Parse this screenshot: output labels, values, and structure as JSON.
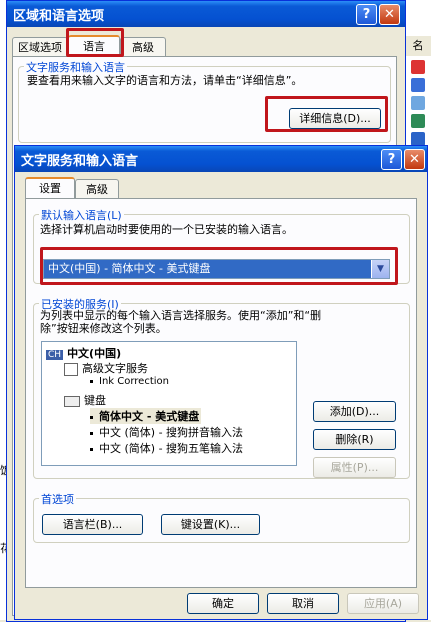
{
  "background": {
    "header_char": "名",
    "left_chars": [
      "饭",
      "花"
    ]
  },
  "win1": {
    "title": "区域和语言选项",
    "help_btn": "?",
    "close_btn": "✕",
    "tabs": [
      "区域选项",
      "语言",
      "高级"
    ],
    "group_label": "文字服务和输入语言",
    "group_text": "要查看用来输入文字的语言和方法，请单击“详细信息”。",
    "details_btn": "详细信息(D)..."
  },
  "win2": {
    "title": "文字服务和输入语言",
    "help_btn": "?",
    "close_btn": "✕",
    "tabs": [
      "设置",
      "高级"
    ],
    "default_group": {
      "label": "默认输入语言(L)",
      "text": "选择计算机启动时要使用的一个已安装的输入语言。",
      "selected": "中文(中国) - 简体中文 - 美式键盘"
    },
    "installed_group": {
      "label": "已安装的服务(I)",
      "text_line1": "为列表中显示的每个输入语言选择服务。使用“添加”和“删",
      "text_line2": "除”按钮来修改这个列表。",
      "tree": {
        "lang_badge": "CH",
        "lang": "中文(中国)",
        "adv_services": "高级文字服务",
        "ink": "Ink Correction",
        "keyboard": "键盘",
        "kb_items": [
          "简体中文 - 美式键盘",
          "中文 (简体) - 搜狗拼音输入法",
          "中文 (简体) - 搜狗五笔输入法"
        ]
      },
      "add_btn": "添加(D)...",
      "remove_btn": "删除(R)",
      "props_btn": "属性(P)..."
    },
    "prefs_group": {
      "label": "首选项",
      "langbar_btn": "语言栏(B)...",
      "keyset_btn": "键设置(K)..."
    },
    "ok_btn": "确定",
    "cancel_btn": "取消",
    "apply_btn": "应用(A)"
  }
}
